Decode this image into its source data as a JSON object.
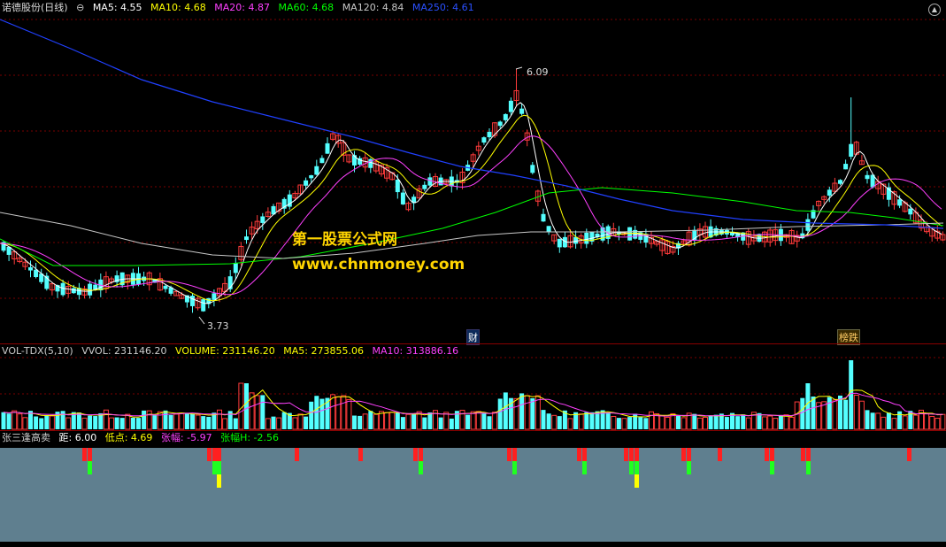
{
  "main": {
    "stock_name": "诺德股份",
    "period": "(日线)",
    "ma5": "MA5: 4.55",
    "ma10": "MA10: 4.68",
    "ma20": "MA20: 4.87",
    "ma60": "MA60: 4.68",
    "ma120": "MA120: 4.84",
    "ma250": "MA250: 4.61",
    "high_label": "6.09",
    "low_label": "3.73",
    "tag_cai": "财",
    "tag_bangdie": "榜跌",
    "watermark_cn": "第一股票公式网",
    "watermark_url": "www.chnmoney.com"
  },
  "volume": {
    "name": "VOL-TDX(5,10)",
    "vvol": "VVOL: 231146.20",
    "volume": "VOLUME: 231146.20",
    "ma5": "MA5: 273855.06",
    "ma10": "MA10: 313886.16"
  },
  "indicator": {
    "name": "张三逢高卖",
    "ju": "距: 6.00",
    "didian": "低点: 4.69",
    "zhangfu": "张幅: -5.97",
    "zhangfu_h": "张幅H: -2.56"
  },
  "colors": {
    "up": "#ff3b3b",
    "down": "#54ffff",
    "ma5": "#ffffff",
    "ma10": "#ffff00",
    "ma20": "#ff40ff",
    "ma60": "#00ff00",
    "ma120": "#c8c8c8",
    "ma250": "#2040ff",
    "indicator_bg": "#5f7f8f"
  }
}
